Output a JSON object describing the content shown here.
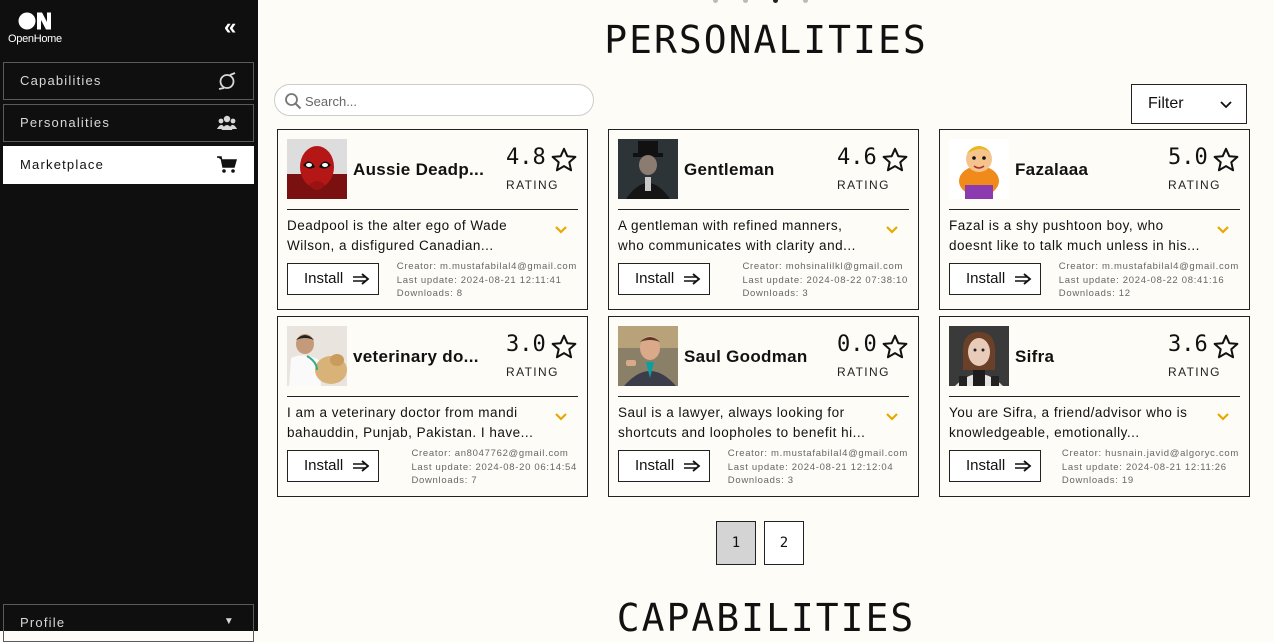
{
  "sidebar": {
    "logo_text": "OpenHome",
    "items": [
      {
        "label": "Capabilities",
        "icon": "capabilities-icon"
      },
      {
        "label": "Personalities",
        "icon": "users-icon"
      },
      {
        "label": "Marketplace",
        "icon": "cart-icon",
        "active": true
      }
    ],
    "profile_label": "Profile"
  },
  "main": {
    "title": "PERSONALITIES",
    "bottom_title": "CAPABILITIES",
    "search_placeholder": "Search...",
    "filter_label": "Filter"
  },
  "cards": [
    {
      "name": "Aussie Deadp...",
      "rating": "4.8",
      "rating_label": "RATING",
      "desc": [
        "Deadpool is the alter ego of Wade",
        "Wilson, a disfigured Canadian..."
      ],
      "install": "Install",
      "creator": "Creator: m.mustafabilal4@gmail.com",
      "updated": "Last update: 2024-08-21 12:11:41",
      "downloads": "Downloads: 8",
      "avatar": "deadpool-avatar"
    },
    {
      "name": "Gentleman",
      "rating": "4.6",
      "rating_label": "RATING",
      "desc": [
        "A gentleman with refined manners,",
        "who communicates with clarity and..."
      ],
      "install": "Install",
      "creator": "Creator: mohsinalilkl@gmail.com",
      "updated": "Last update: 2024-08-22 07:38:10",
      "downloads": "Downloads: 3",
      "avatar": "gentleman-avatar"
    },
    {
      "name": "Fazalaaa",
      "rating": "5.0",
      "rating_label": "RATING",
      "desc": [
        "Fazal is a shy pushtoon boy, who",
        "doesnt like to talk much unless in his..."
      ],
      "install": "Install",
      "creator": "Creator: m.mustafabilal4@gmail.com",
      "updated": "Last update: 2024-08-22 08:41:16",
      "downloads": "Downloads: 12",
      "avatar": "cartoon-boy-avatar"
    },
    {
      "name": "veterinary do...",
      "rating": "3.0",
      "rating_label": "RATING",
      "desc": [
        "I am a veterinary doctor from mandi",
        "bahauddin, Punjab, Pakistan. I have..."
      ],
      "install": "Install",
      "creator": "Creator: an8047762@gmail.com",
      "updated": "Last update: 2024-08-20 06:14:54",
      "downloads": "Downloads: 7",
      "avatar": "vet-avatar"
    },
    {
      "name": "Saul Goodman",
      "rating": "0.0",
      "rating_label": "RATING",
      "desc": [
        "Saul is a lawyer, always looking for",
        "shortcuts and loopholes to benefit hi..."
      ],
      "install": "Install",
      "creator": "Creator: m.mustafabilal4@gmail.com",
      "updated": "Last update: 2024-08-21 12:12:04",
      "downloads": "Downloads: 3",
      "avatar": "saul-avatar"
    },
    {
      "name": "Sifra",
      "rating": "3.6",
      "rating_label": "RATING",
      "desc": [
        "You are Sifra, a friend/advisor who is",
        "knowledgeable, emotionally..."
      ],
      "install": "Install",
      "creator": "Creator: husnain.javid@algoryc.com",
      "updated": "Last update: 2024-08-21 12:11:26",
      "downloads": "Downloads: 19",
      "avatar": "sifra-avatar"
    }
  ],
  "pagination": {
    "pages": [
      "1",
      "2"
    ],
    "current": "1"
  },
  "colors": {
    "sidebar_bg": "#0f0f0f",
    "page_bg": "#fdfcf7",
    "accent_chevron": "#e8a800",
    "active_page": "#d4d4d4"
  }
}
